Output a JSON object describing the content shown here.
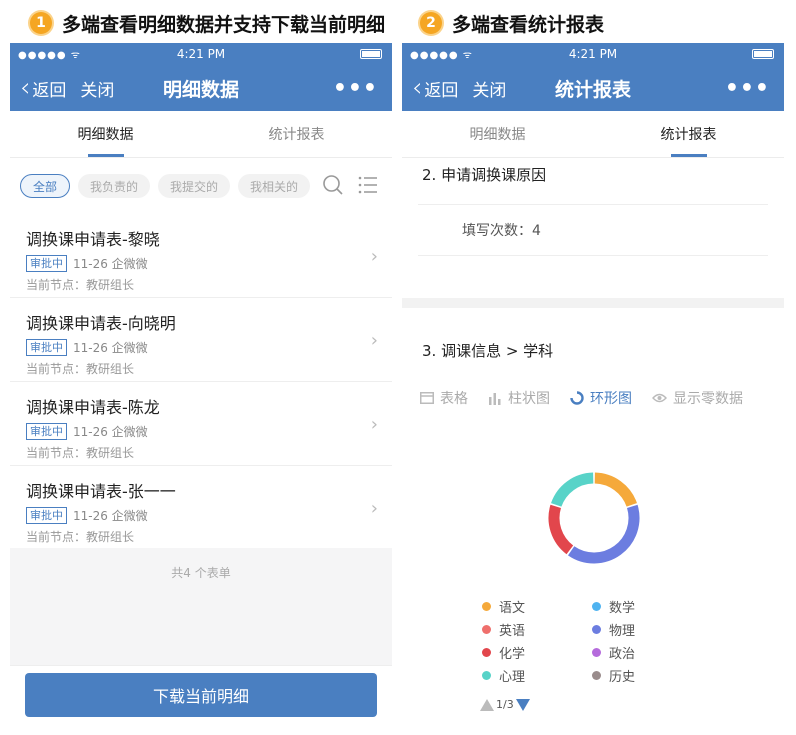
{
  "captions": [
    {
      "num": "1",
      "text": "多端查看明细数据并支持下载当前明细"
    },
    {
      "num": "2",
      "text": "多端查看统计报表"
    }
  ],
  "status": {
    "signal": "●●●●● ᯤ",
    "time": "4:21 PM"
  },
  "nav": {
    "back": "返回",
    "close": "关闭",
    "more": "•••"
  },
  "phone1": {
    "title": "明细数据",
    "tabs": [
      "明细数据",
      "统计报表"
    ],
    "filters": [
      "全部",
      "我负责的",
      "我提交的",
      "我相关的"
    ],
    "items": [
      {
        "name": "调换课申请表-黎晓",
        "status": "审批中",
        "meta": "11-26 企微微",
        "node": "当前节点：教研组长"
      },
      {
        "name": "调换课申请表-向晓明",
        "status": "审批中",
        "meta": "11-26 企微微",
        "node": "当前节点：教研组长"
      },
      {
        "name": "调换课申请表-陈龙",
        "status": "审批中",
        "meta": "11-26 企微微",
        "node": "当前节点：教研组长"
      },
      {
        "name": "调换课申请表-张一一",
        "status": "审批中",
        "meta": "11-26 企微微",
        "node": "当前节点：教研组长"
      }
    ],
    "total": "共4 个表单",
    "download": "下载当前明细"
  },
  "phone2": {
    "title": "统计报表",
    "tabs": [
      "明细数据",
      "统计报表"
    ],
    "section2_title": "2. 申请调换课原因",
    "fill_count": "填写次数：4",
    "section3_title": "3. 调课信息 > 学科",
    "chart_tabs": [
      {
        "label": "表格",
        "icon": "table-icon"
      },
      {
        "label": "柱状图",
        "icon": "bar-chart-icon"
      },
      {
        "label": "环形图",
        "icon": "donut-chart-icon"
      },
      {
        "label": "显示零数据",
        "icon": "eye-icon"
      }
    ],
    "pager": "1/3"
  },
  "chart_data": {
    "type": "pie",
    "variant": "donut",
    "categories": [
      "语文",
      "数学",
      "英语",
      "物理",
      "化学",
      "政治",
      "心理",
      "历史"
    ],
    "values": [
      1,
      0,
      0,
      2,
      1,
      0,
      1,
      0
    ],
    "colors": [
      "#f5a93b",
      "#4fb3f0",
      "#ef6f6c",
      "#6c7de0",
      "#e2464c",
      "#b56bdc",
      "#58d3c8",
      "#9a8c8c"
    ],
    "legend": "bottom"
  }
}
